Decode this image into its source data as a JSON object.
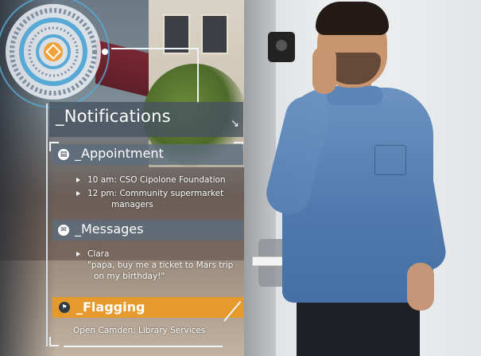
{
  "notifications": {
    "title": "_Notifications",
    "corner_icon": "arrow-down-right-icon"
  },
  "appointment": {
    "title": "_Appointment",
    "icon": "calendar-icon",
    "items": [
      "10 am: CSO Cipolone Foundation",
      "12 pm: Community supermarket",
      "managers"
    ]
  },
  "messages": {
    "title": "_Messages",
    "icon": "envelope-icon",
    "sender": "Clara",
    "text_line1": "\"papa, buy me a ticket to Mars trip",
    "text_line2": "on my birthday!\""
  },
  "flagging": {
    "title": "_Flagging",
    "icon": "flag-icon",
    "item": "Open Camden: Library Services"
  },
  "colors": {
    "flag_accent": "#e79a2c",
    "hud_blue": "#59a9d6",
    "hud_orange": "#f0a23a"
  }
}
